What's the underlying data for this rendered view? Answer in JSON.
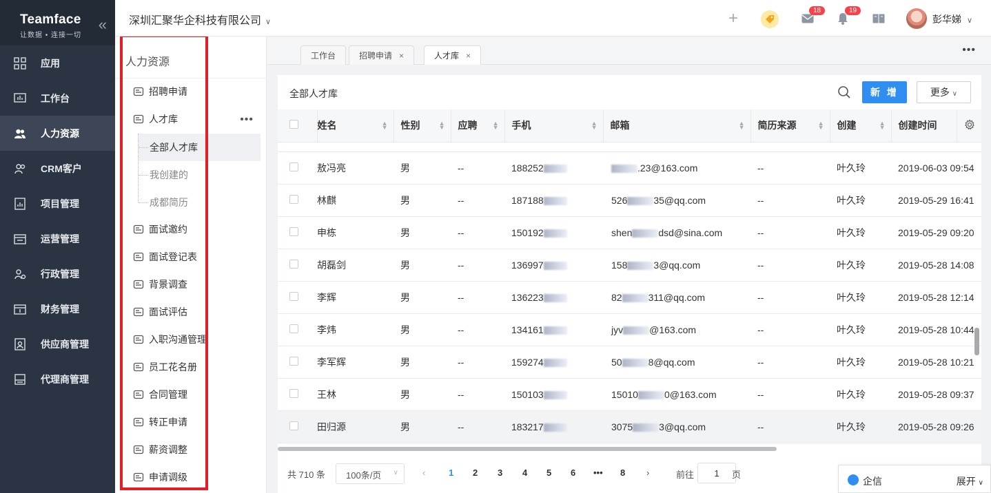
{
  "brand": {
    "logo": "Teamface",
    "slogan": "让数据 • 连接一切"
  },
  "nav": [
    {
      "label": "应用",
      "icon": "apps-icon"
    },
    {
      "label": "工作台",
      "icon": "dashboard-icon"
    },
    {
      "label": "人力资源",
      "icon": "users-icon",
      "active": true
    },
    {
      "label": "CRM客户",
      "icon": "crm-icon"
    },
    {
      "label": "项目管理",
      "icon": "project-icon"
    },
    {
      "label": "运营管理",
      "icon": "operations-icon"
    },
    {
      "label": "行政管理",
      "icon": "admin-icon"
    },
    {
      "label": "财务管理",
      "icon": "finance-icon"
    },
    {
      "label": "供应商管理",
      "icon": "supplier-icon"
    },
    {
      "label": "代理商管理",
      "icon": "agent-icon"
    }
  ],
  "header": {
    "company": "深圳汇聚华企科技有限公司",
    "mail_count": "18",
    "notify_count": "19",
    "user": "彭华娣"
  },
  "sub": {
    "title": "人力资源",
    "items": [
      {
        "label": "招聘申请",
        "icon": "recruit-icon"
      },
      {
        "label": "人才库",
        "icon": "talent-icon"
      },
      {
        "label": "面试邀约",
        "icon": "invite-icon"
      },
      {
        "label": "面试登记表",
        "icon": "register-icon"
      },
      {
        "label": "背景调查",
        "icon": "background-icon"
      },
      {
        "label": "面试评估",
        "icon": "evaluate-icon"
      },
      {
        "label": "入职沟通管理",
        "icon": "onboard-icon"
      },
      {
        "label": "员工花名册",
        "icon": "roster-icon"
      },
      {
        "label": "合同管理",
        "icon": "contract-icon"
      },
      {
        "label": "转正申请",
        "icon": "regular-icon"
      },
      {
        "label": "薪资调整",
        "icon": "salary-icon"
      },
      {
        "label": "申请调级",
        "icon": "level-icon"
      }
    ],
    "children": [
      {
        "label": "全部人才库",
        "active": true
      },
      {
        "label": "我创建的"
      },
      {
        "label": "成都简历"
      }
    ]
  },
  "tabs": [
    {
      "label": "工作台",
      "closable": false
    },
    {
      "label": "招聘申请",
      "closable": true
    },
    {
      "label": "人才库",
      "closable": true,
      "active": true
    }
  ],
  "card": {
    "title": "全部人才库",
    "new_label": "新 增",
    "more_label": "更多"
  },
  "columns": [
    "姓名",
    "性别",
    "应聘",
    "手机",
    "邮箱",
    "简历来源",
    "创建",
    "创建时间"
  ],
  "rows": [
    {
      "name": "敖冯亮",
      "gender": "男",
      "apply": "--",
      "phone": "188252",
      "email_a": "",
      "email_b": ".23@163.com",
      "source": "--",
      "creator": "叶久玲",
      "time": "2019-06-03 09:54"
    },
    {
      "name": "林麒",
      "gender": "男",
      "apply": "--",
      "phone": "187188",
      "email_a": "526",
      "email_b": "35@qq.com",
      "source": "--",
      "creator": "叶久玲",
      "time": "2019-05-29 16:41"
    },
    {
      "name": "申栋",
      "gender": "男",
      "apply": "--",
      "phone": "150192",
      "email_a": "shen",
      "email_b": "dsd@sina.com",
      "source": "--",
      "creator": "叶久玲",
      "time": "2019-05-29 09:20"
    },
    {
      "name": "胡磊剑",
      "gender": "男",
      "apply": "--",
      "phone": "136997",
      "email_a": "158",
      "email_b": "3@qq.com",
      "source": "--",
      "creator": "叶久玲",
      "time": "2019-05-28 14:08"
    },
    {
      "name": "李辉",
      "gender": "男",
      "apply": "--",
      "phone": "136223",
      "email_a": "82",
      "email_b": "311@qq.com",
      "source": "--",
      "creator": "叶久玲",
      "time": "2019-05-28 12:14"
    },
    {
      "name": "李炜",
      "gender": "男",
      "apply": "--",
      "phone": "134161",
      "email_a": "jyv",
      "email_b": "@163.com",
      "source": "--",
      "creator": "叶久玲",
      "time": "2019-05-28 10:44"
    },
    {
      "name": "李军辉",
      "gender": "男",
      "apply": "--",
      "phone": "159274",
      "email_a": "50",
      "email_b": "8@qq.com",
      "source": "--",
      "creator": "叶久玲",
      "time": "2019-05-28 10:21"
    },
    {
      "name": "王林",
      "gender": "男",
      "apply": "--",
      "phone": "150103",
      "email_a": "15010",
      "email_b": "0@163.com",
      "source": "--",
      "creator": "叶久玲",
      "time": "2019-05-28 09:37"
    },
    {
      "name": "田归源",
      "gender": "男",
      "apply": "--",
      "phone": "183217",
      "email_a": "3075",
      "email_b": "3@qq.com",
      "source": "--",
      "creator": "叶久玲",
      "time": "2019-05-28 09:26",
      "highlight": true
    }
  ],
  "pager": {
    "total": "共 710 条",
    "size": "100条/页",
    "pages": [
      "1",
      "2",
      "3",
      "4",
      "5",
      "6",
      "•••",
      "8"
    ],
    "current": "1",
    "goto": "前往",
    "goto_value": "1",
    "suffix": "页"
  },
  "qixin": {
    "label": "企信",
    "expand": "展开"
  }
}
